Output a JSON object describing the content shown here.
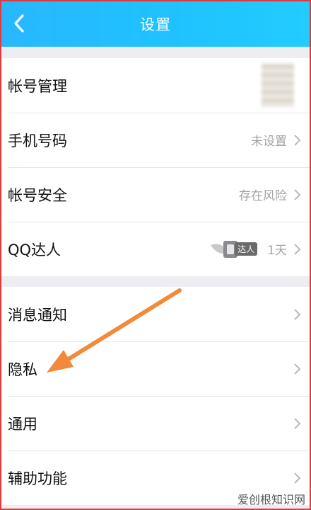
{
  "header": {
    "title": "设置"
  },
  "account_group": [
    {
      "label": "帐号管理",
      "value": ""
    },
    {
      "label": "手机号码",
      "value": "未设置"
    },
    {
      "label": "帐号安全",
      "value": "存在风险"
    },
    {
      "label": "QQ达人",
      "badge": "达人",
      "value": "1天"
    }
  ],
  "general_group": [
    {
      "label": "消息通知"
    },
    {
      "label": "隐私"
    },
    {
      "label": "通用"
    },
    {
      "label": "辅助功能"
    }
  ],
  "annotation": {
    "color": "#f28a3c"
  },
  "watermark": "爱创根知识网",
  "colors": {
    "header": "#22bfff",
    "chevron": "#b8b8bd"
  }
}
